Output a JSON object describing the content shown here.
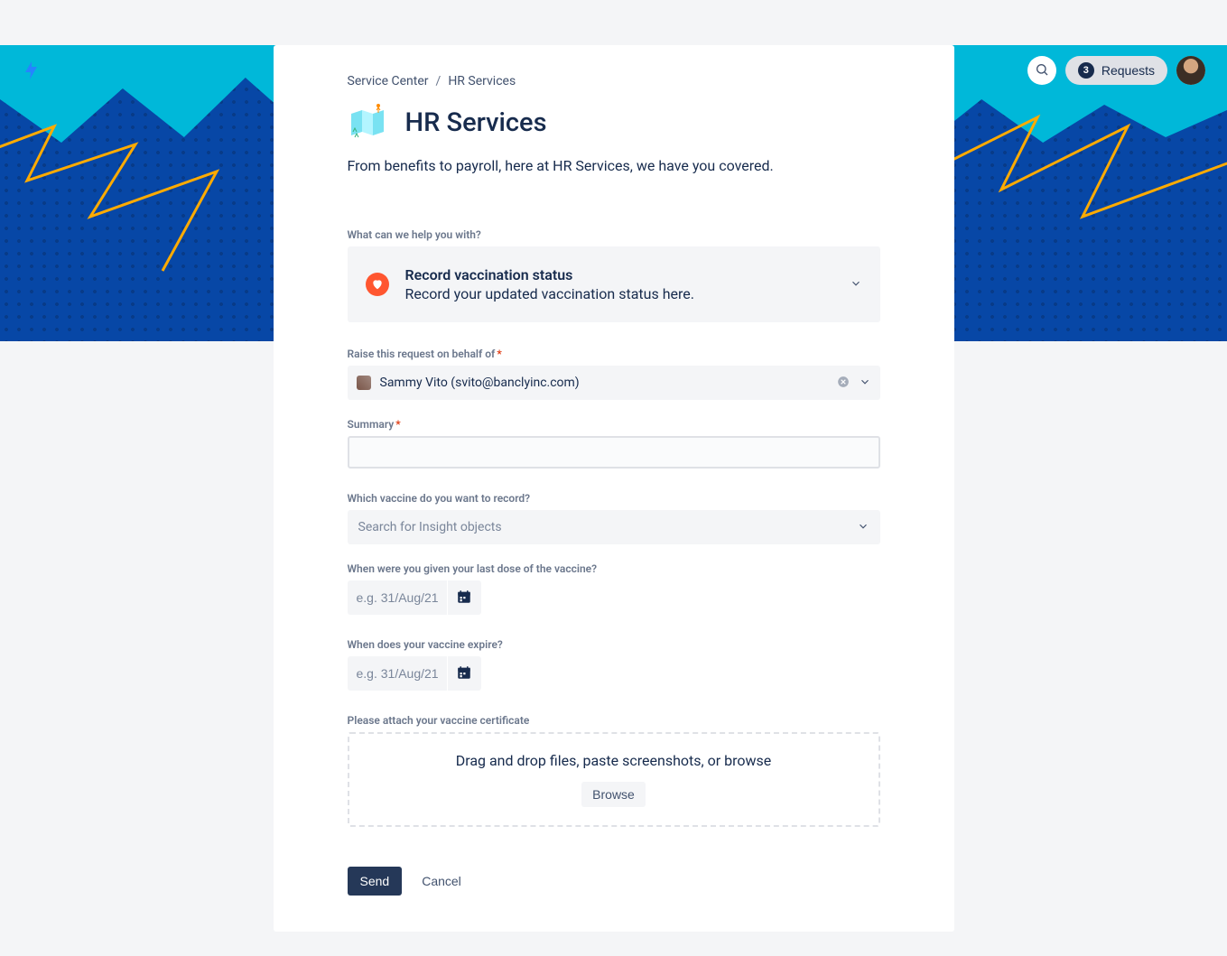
{
  "topbar": {
    "requests_count": "3",
    "requests_label": "Requests"
  },
  "breadcrumb": {
    "root": "Service Center",
    "current": "HR Services"
  },
  "page": {
    "title": "HR Services",
    "description": "From benefits to payroll, here at HR Services, we have you covered."
  },
  "form": {
    "help_label": "What can we help you with?",
    "request_type": {
      "title": "Record vaccination status",
      "description": "Record your updated vaccination status here."
    },
    "behalf_label": "Raise this request on behalf of",
    "behalf_value": "Sammy Vito (svito@banclyinc.com)",
    "summary_label": "Summary",
    "summary_value": "",
    "vaccine_label": "Which vaccine do you want to record?",
    "vaccine_placeholder": "Search for Insight objects",
    "last_dose_label": "When were you given your last dose of the vaccine?",
    "date_placeholder": "e.g. 31/Aug/21",
    "expire_label": "When does your vaccine expire?",
    "attach_label": "Please attach your vaccine certificate",
    "attach_text": "Drag and drop files, paste screenshots, or browse",
    "browse_label": "Browse",
    "send_label": "Send",
    "cancel_label": "Cancel"
  }
}
